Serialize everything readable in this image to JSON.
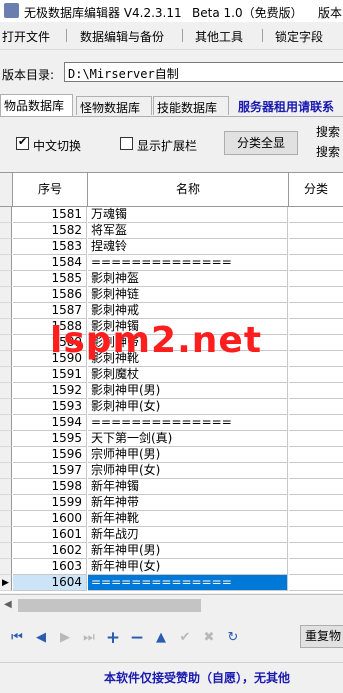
{
  "title": {
    "app": "无极数据库编辑器 V4.2.3.11",
    "beta": "Beta 1.0（免费版）",
    "version_tail": "版本"
  },
  "menu": [
    "打开文件",
    "数据编辑与备份",
    "其他工具",
    "锁定字段"
  ],
  "directory": {
    "label": "版本目录:",
    "value": "D:\\Mirserver自制"
  },
  "tabs": [
    "物品数据库",
    "怪物数据库",
    "技能数据库"
  ],
  "tab_notice": "服务器租用请联系",
  "options": {
    "chinese_toggle": "中文切换",
    "chinese_checked": true,
    "show_ext": "显示扩展栏",
    "show_ext_checked": false,
    "category_all": "分类全显",
    "search1": "搜索",
    "search2": "搜索"
  },
  "table": {
    "headers": [
      "序号",
      "名称",
      "分类"
    ],
    "rows": [
      {
        "no": "1581",
        "name": "万魂镯"
      },
      {
        "no": "1582",
        "name": "将军盔"
      },
      {
        "no": "1583",
        "name": "捏魂铃"
      },
      {
        "no": "1584",
        "name": "=============="
      },
      {
        "no": "1585",
        "name": "影刺神盔"
      },
      {
        "no": "1586",
        "name": "影刺神链"
      },
      {
        "no": "1587",
        "name": "影刺神戒"
      },
      {
        "no": "1588",
        "name": "影刺神镯"
      },
      {
        "no": "1589",
        "name": "影刺神带"
      },
      {
        "no": "1590",
        "name": "影刺神靴"
      },
      {
        "no": "1591",
        "name": "影刺魔杖"
      },
      {
        "no": "1592",
        "name": "影刺神甲(男)"
      },
      {
        "no": "1593",
        "name": "影刺神甲(女)"
      },
      {
        "no": "1594",
        "name": "=============="
      },
      {
        "no": "1595",
        "name": "天下第一剑(真)"
      },
      {
        "no": "1596",
        "name": "宗师神甲(男)"
      },
      {
        "no": "1597",
        "name": "宗师神甲(女)"
      },
      {
        "no": "1598",
        "name": "新年神镯"
      },
      {
        "no": "1599",
        "name": "新年神带"
      },
      {
        "no": "1600",
        "name": "新年神靴"
      },
      {
        "no": "1601",
        "name": "新年战刃"
      },
      {
        "no": "1602",
        "name": "新年神甲(男)"
      },
      {
        "no": "1603",
        "name": "新年神甲(女)"
      },
      {
        "no": "1604",
        "name": "=============="
      }
    ],
    "selected_row": 23
  },
  "nav_icons": [
    "first-icon",
    "prior-icon",
    "next-icon",
    "last-icon",
    "insert-icon",
    "delete-icon",
    "edit-icon",
    "post-icon",
    "cancel-icon",
    "refresh-icon"
  ],
  "reset_label": "重复物",
  "footer": "本软件仅接受赞助（自愿），无其他",
  "watermark": "lspm2.net",
  "colors": {
    "accent": "#0078d7",
    "notice": "#1a1ab0",
    "watermark": "#ff1e1e"
  }
}
